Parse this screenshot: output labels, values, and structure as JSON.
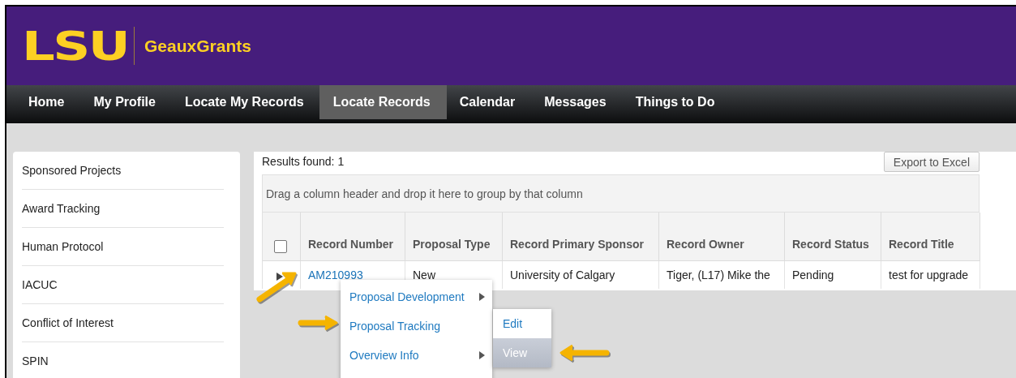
{
  "header": {
    "logo": "LSU",
    "app_name": "GeauxGrants"
  },
  "nav": [
    {
      "label": "Home",
      "selected": false
    },
    {
      "label": "My Profile",
      "selected": false
    },
    {
      "label": "Locate My Records",
      "selected": false
    },
    {
      "label": "Locate Records",
      "selected": true
    },
    {
      "label": "Calendar",
      "selected": false
    },
    {
      "label": "Messages",
      "selected": false
    },
    {
      "label": "Things to Do",
      "selected": false
    }
  ],
  "sidebar": {
    "items": [
      "Sponsored Projects",
      "Award Tracking",
      "Human Protocol",
      "IACUC",
      "Conflict of Interest",
      "SPIN"
    ]
  },
  "results": {
    "count_text": "Results found: 1",
    "export_button": "Export to Excel",
    "group_hint": "Drag a column header and drop it here to group by that column"
  },
  "table": {
    "select_all_checked": false,
    "columns": [
      "Record Number",
      "Proposal Type",
      "Record Primary Sponsor",
      "Record Owner",
      "Record Status",
      "Record Title"
    ],
    "rows": [
      {
        "expanded": false,
        "cells": [
          "AM210993",
          "New",
          "University of Calgary",
          "Tiger, (L17) Mike the",
          "Pending",
          "test for upgrade"
        ]
      }
    ]
  },
  "context_menu": {
    "items": [
      {
        "label": "Proposal Development",
        "submenu": true
      },
      {
        "label": "Proposal Tracking",
        "submenu": false
      },
      {
        "label": "Overview Info",
        "submenu": true
      }
    ]
  },
  "submenu": {
    "items": [
      {
        "label": "Edit",
        "selected": false
      },
      {
        "label": "View",
        "selected": true
      }
    ]
  }
}
